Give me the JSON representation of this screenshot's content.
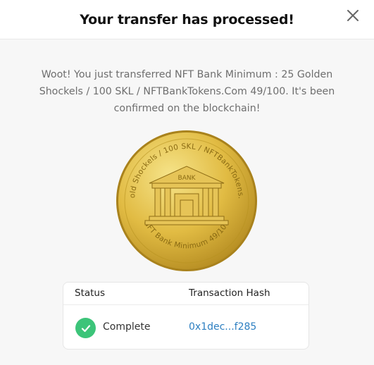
{
  "modal": {
    "title": "Your transfer has processed!",
    "close_icon": "close-icon"
  },
  "message": "Woot! You just transferred NFT Bank Minimum : 25 Golden Shockels / 100 SKL / NFTBankTokens.Com 49/100. It's been confirmed on the blockchain!",
  "coin": {
    "top_text": "25 Gold Shockels / 100 SKL / NFTBankTokens.Com",
    "bottom_text": "NFT Bank Minimum 49/100",
    "building_label": "BANK",
    "colors": {
      "gold_light": "#f3dc78",
      "gold_mid": "#dcb43a",
      "gold_dark": "#a9821c"
    }
  },
  "transaction": {
    "headers": {
      "status": "Status",
      "hash": "Transaction Hash"
    },
    "status": "Complete",
    "status_icon": "check-circle-icon",
    "status_color": "#3cc479",
    "hash": "0x1dec...f285",
    "link_color": "#2d7fc1"
  }
}
